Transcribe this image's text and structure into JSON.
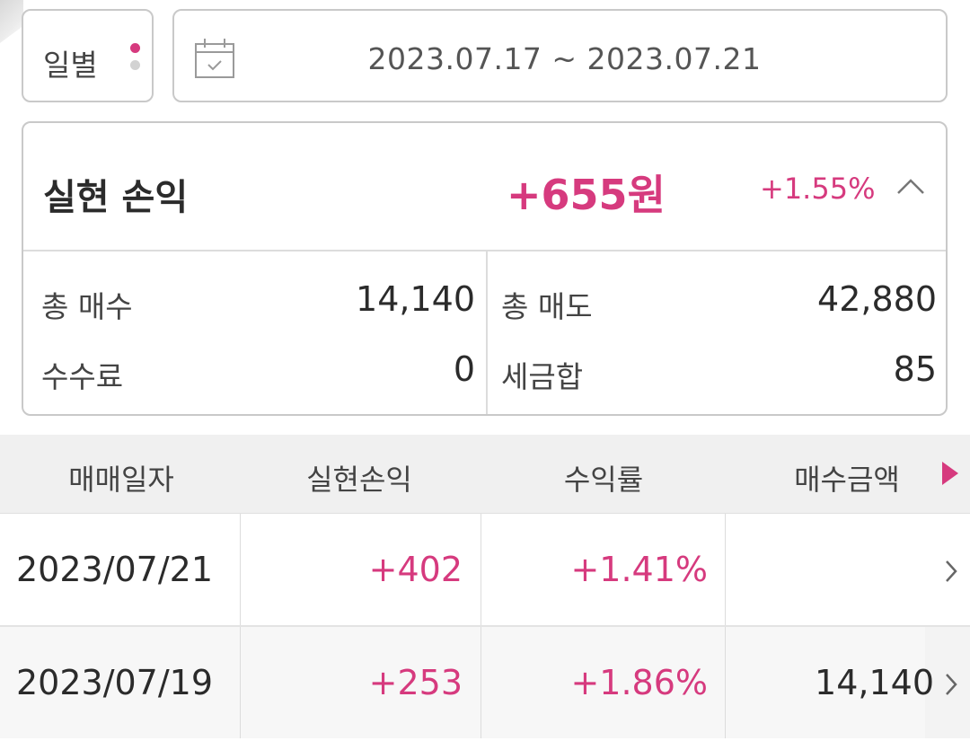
{
  "filter": {
    "period_label": "일별",
    "date_range": "2023.07.17 ~ 2023.07.21"
  },
  "summary": {
    "title": "실현 손익",
    "amount": "+655원",
    "rate": "+1.55%",
    "stats": {
      "total_buy_label": "총 매수",
      "total_buy_value": "14,140",
      "total_sell_label": "총 매도",
      "total_sell_value": "42,880",
      "fee_label": "수수료",
      "fee_value": "0",
      "tax_label": "세금합",
      "tax_value": "85"
    }
  },
  "table": {
    "headers": [
      "매매일자",
      "실현손익",
      "수익률",
      "매수금액"
    ],
    "rows": [
      {
        "date": "2023/07/21",
        "pl": "+402",
        "rate": "+1.41%",
        "amount": ""
      },
      {
        "date": "2023/07/19",
        "pl": "+253",
        "rate": "+1.86%",
        "amount": "14,140"
      }
    ]
  },
  "colors": {
    "accent": "#d63a7e",
    "border": "#c9c9c9",
    "header_bg": "#f0f0f0"
  }
}
